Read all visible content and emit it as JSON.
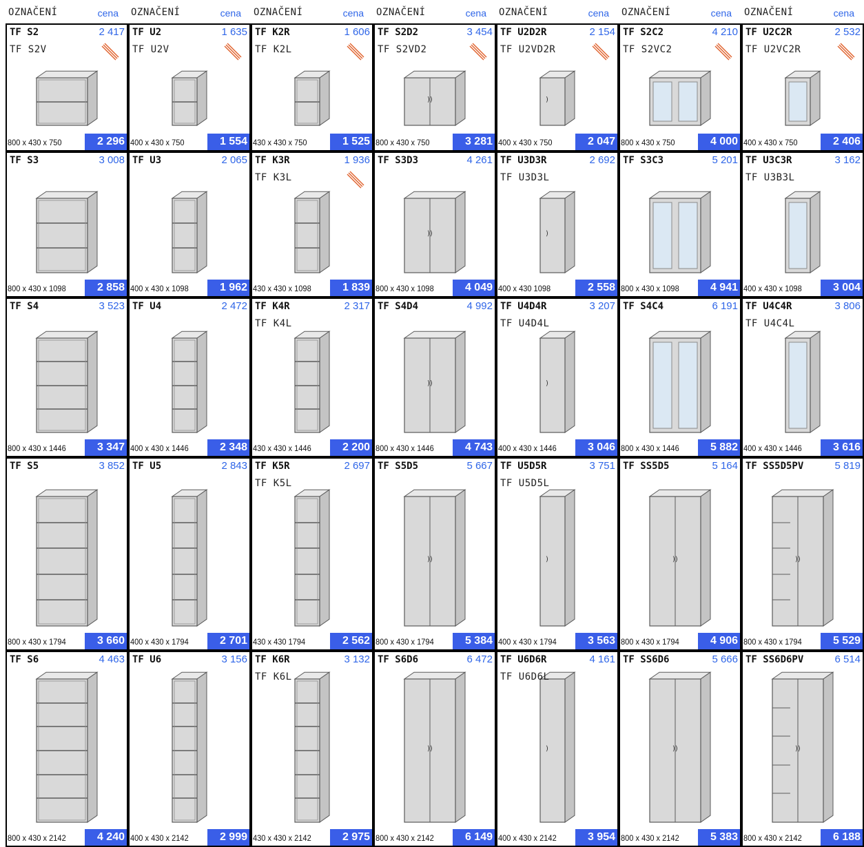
{
  "header": {
    "label": "OZNAČENÍ",
    "price_label": "cena"
  },
  "rows": [
    {
      "cells": [
        {
          "code": "TF S2",
          "price": "2 417",
          "alt": "TF S2V",
          "dims": "800 x 430 x 750",
          "price2": "2 296",
          "kind": "open-wide",
          "hatch": true
        },
        {
          "code": "TF U2",
          "price": "1 635",
          "alt": "TF U2V",
          "dims": "400 x 430 x 750",
          "price2": "1 554",
          "kind": "open-narrow",
          "hatch": true
        },
        {
          "code": "TF K2R",
          "price": "1 606",
          "alt": "TF K2L",
          "dims": "430 x 430 x 750",
          "price2": "1 525",
          "kind": "corner",
          "hatch": true
        },
        {
          "code": "TF S2D2",
          "price": "3 454",
          "alt": "TF S2VD2",
          "dims": "800 x 430 x 750",
          "price2": "3 281",
          "kind": "door-wide",
          "hatch": true
        },
        {
          "code": "TF U2D2R",
          "price": "2 154",
          "alt": "TF U2VD2R",
          "dims": "400 x 430 x 750",
          "price2": "2 047",
          "kind": "door-narrow",
          "hatch": true
        },
        {
          "code": "TF S2C2",
          "price": "4 210",
          "alt": "TF S2VC2",
          "dims": "800 x 430 x 750",
          "price2": "4 000",
          "kind": "glass-wide",
          "hatch": true
        },
        {
          "code": "TF U2C2R",
          "price": "2 532",
          "alt": "TF U2VC2R",
          "dims": "400 x 430 x 750",
          "price2": "2 406",
          "kind": "glass-narrow",
          "hatch": true
        }
      ]
    },
    {
      "cells": [
        {
          "code": "TF S3",
          "price": "3 008",
          "alt": "",
          "dims": "800 x 430 x 1098",
          "price2": "2 858",
          "kind": "open-wide",
          "hatch": false
        },
        {
          "code": "TF U3",
          "price": "2 065",
          "alt": "",
          "dims": "400 x 430 x 1098",
          "price2": "1 962",
          "kind": "open-narrow",
          "hatch": false
        },
        {
          "code": "TF K3R",
          "price": "1 936",
          "alt": "TF K3L",
          "dims": "430 x 430 x 1098",
          "price2": "1 839",
          "kind": "corner",
          "hatch": true
        },
        {
          "code": "TF S3D3",
          "price": "4 261",
          "alt": "",
          "dims": "800 x 430 x 1098",
          "price2": "4 049",
          "kind": "door-wide",
          "hatch": false
        },
        {
          "code": "TF U3D3R",
          "price": "2 692",
          "alt": "TF U3D3L",
          "dims": "400 x 430 1098",
          "price2": "2 558",
          "kind": "door-narrow",
          "hatch": false
        },
        {
          "code": "TF S3C3",
          "price": "5 201",
          "alt": "",
          "dims": "800 x 430 x 1098",
          "price2": "4 941",
          "kind": "glass-wide",
          "hatch": false
        },
        {
          "code": "TF U3C3R",
          "price": "3 162",
          "alt": "TF U3B3L",
          "dims": "400 x 430 x 1098",
          "price2": "3 004",
          "kind": "glass-narrow",
          "hatch": false
        }
      ]
    },
    {
      "cells": [
        {
          "code": "TF S4",
          "price": "3 523",
          "alt": "",
          "dims": "800 x 430 x 1446",
          "price2": "3 347",
          "kind": "open-wide",
          "hatch": false
        },
        {
          "code": "TF U4",
          "price": "2 472",
          "alt": "",
          "dims": "400 x 430 x 1446",
          "price2": "2 348",
          "kind": "open-narrow",
          "hatch": false
        },
        {
          "code": "TF K4R",
          "price": "2 317",
          "alt": "TF K4L",
          "dims": "430 x 430 x 1446",
          "price2": "2 200",
          "kind": "corner",
          "hatch": false
        },
        {
          "code": "TF S4D4",
          "price": "4 992",
          "alt": "",
          "dims": "800 x 430 x 1446",
          "price2": "4 743",
          "kind": "door-wide",
          "hatch": false
        },
        {
          "code": "TF U4D4R",
          "price": "3 207",
          "alt": "TF U4D4L",
          "dims": "400 x 430 x 1446",
          "price2": "3 046",
          "kind": "door-narrow",
          "hatch": false
        },
        {
          "code": "TF S4C4",
          "price": "6 191",
          "alt": "",
          "dims": "800 x 430 x 1446",
          "price2": "5 882",
          "kind": "glass-wide",
          "hatch": false
        },
        {
          "code": "TF U4C4R",
          "price": "3 806",
          "alt": "TF U4C4L",
          "dims": "400 x 430 x 1446",
          "price2": "3 616",
          "kind": "glass-narrow",
          "hatch": false
        }
      ]
    },
    {
      "cells": [
        {
          "code": "TF S5",
          "price": "3 852",
          "alt": "",
          "dims": "800 x 430 x 1794",
          "price2": "3 660",
          "kind": "open-wide",
          "hatch": false
        },
        {
          "code": "TF U5",
          "price": "2 843",
          "alt": "",
          "dims": "400 x 430 x 1794",
          "price2": "2 701",
          "kind": "open-narrow",
          "hatch": false
        },
        {
          "code": "TF K5R",
          "price": "2 697",
          "alt": "TF K5L",
          "dims": "430 x 430 1794",
          "price2": "2 562",
          "kind": "corner",
          "hatch": false
        },
        {
          "code": "TF S5D5",
          "price": "5 667",
          "alt": "",
          "dims": "800 x 430 x 1794",
          "price2": "5 384",
          "kind": "door-wide",
          "hatch": false
        },
        {
          "code": "TF U5D5R",
          "price": "3 751",
          "alt": "TF U5D5L",
          "dims": "400 x 430 x 1794",
          "price2": "3 563",
          "kind": "door-narrow",
          "hatch": false
        },
        {
          "code": "TF SS5D5",
          "price": "5 164",
          "alt": "",
          "dims": "800 x 430 x 1794",
          "price2": "4 906",
          "kind": "wardrobe",
          "hatch": false
        },
        {
          "code": "TF SS5D5PV",
          "price": "5 819",
          "alt": "",
          "dims": "800 x 430 x 1794",
          "price2": "5 529",
          "kind": "wardrobe-shelf",
          "hatch": false
        }
      ]
    },
    {
      "cells": [
        {
          "code": "TF S6",
          "price": "4 463",
          "alt": "",
          "dims": "800 x 430 x 2142",
          "price2": "4 240",
          "kind": "open-wide",
          "hatch": false
        },
        {
          "code": "TF U6",
          "price": "3 156",
          "alt": "",
          "dims": "400 x 430 x 2142",
          "price2": "2 999",
          "kind": "open-narrow",
          "hatch": false
        },
        {
          "code": "TF K6R",
          "price": "3 132",
          "alt": "TF K6L",
          "dims": "430 x 430 x 2142",
          "price2": "2 975",
          "kind": "corner",
          "hatch": false
        },
        {
          "code": "TF S6D6",
          "price": "6 472",
          "alt": "",
          "dims": "800 x 430 x 2142",
          "price2": "6 149",
          "kind": "door-wide",
          "hatch": false
        },
        {
          "code": "TF U6D6R",
          "price": "4 161",
          "alt": "TF U6D6L",
          "dims": "400 x 430 x 2142",
          "price2": "3 954",
          "kind": "door-narrow",
          "hatch": false
        },
        {
          "code": "TF SS6D6",
          "price": "5 666",
          "alt": "",
          "dims": "800 x 430 x 2142",
          "price2": "5 383",
          "kind": "wardrobe",
          "hatch": false
        },
        {
          "code": "TF SS6D6PV",
          "price": "6 514",
          "alt": "",
          "dims": "800 x 430 x 2142",
          "price2": "6 188",
          "kind": "wardrobe-shelf",
          "hatch": false
        }
      ]
    }
  ],
  "colors": {
    "accent": "#2f66e8",
    "price_box": "#3a5ee8",
    "hatch": "#e0602a"
  }
}
